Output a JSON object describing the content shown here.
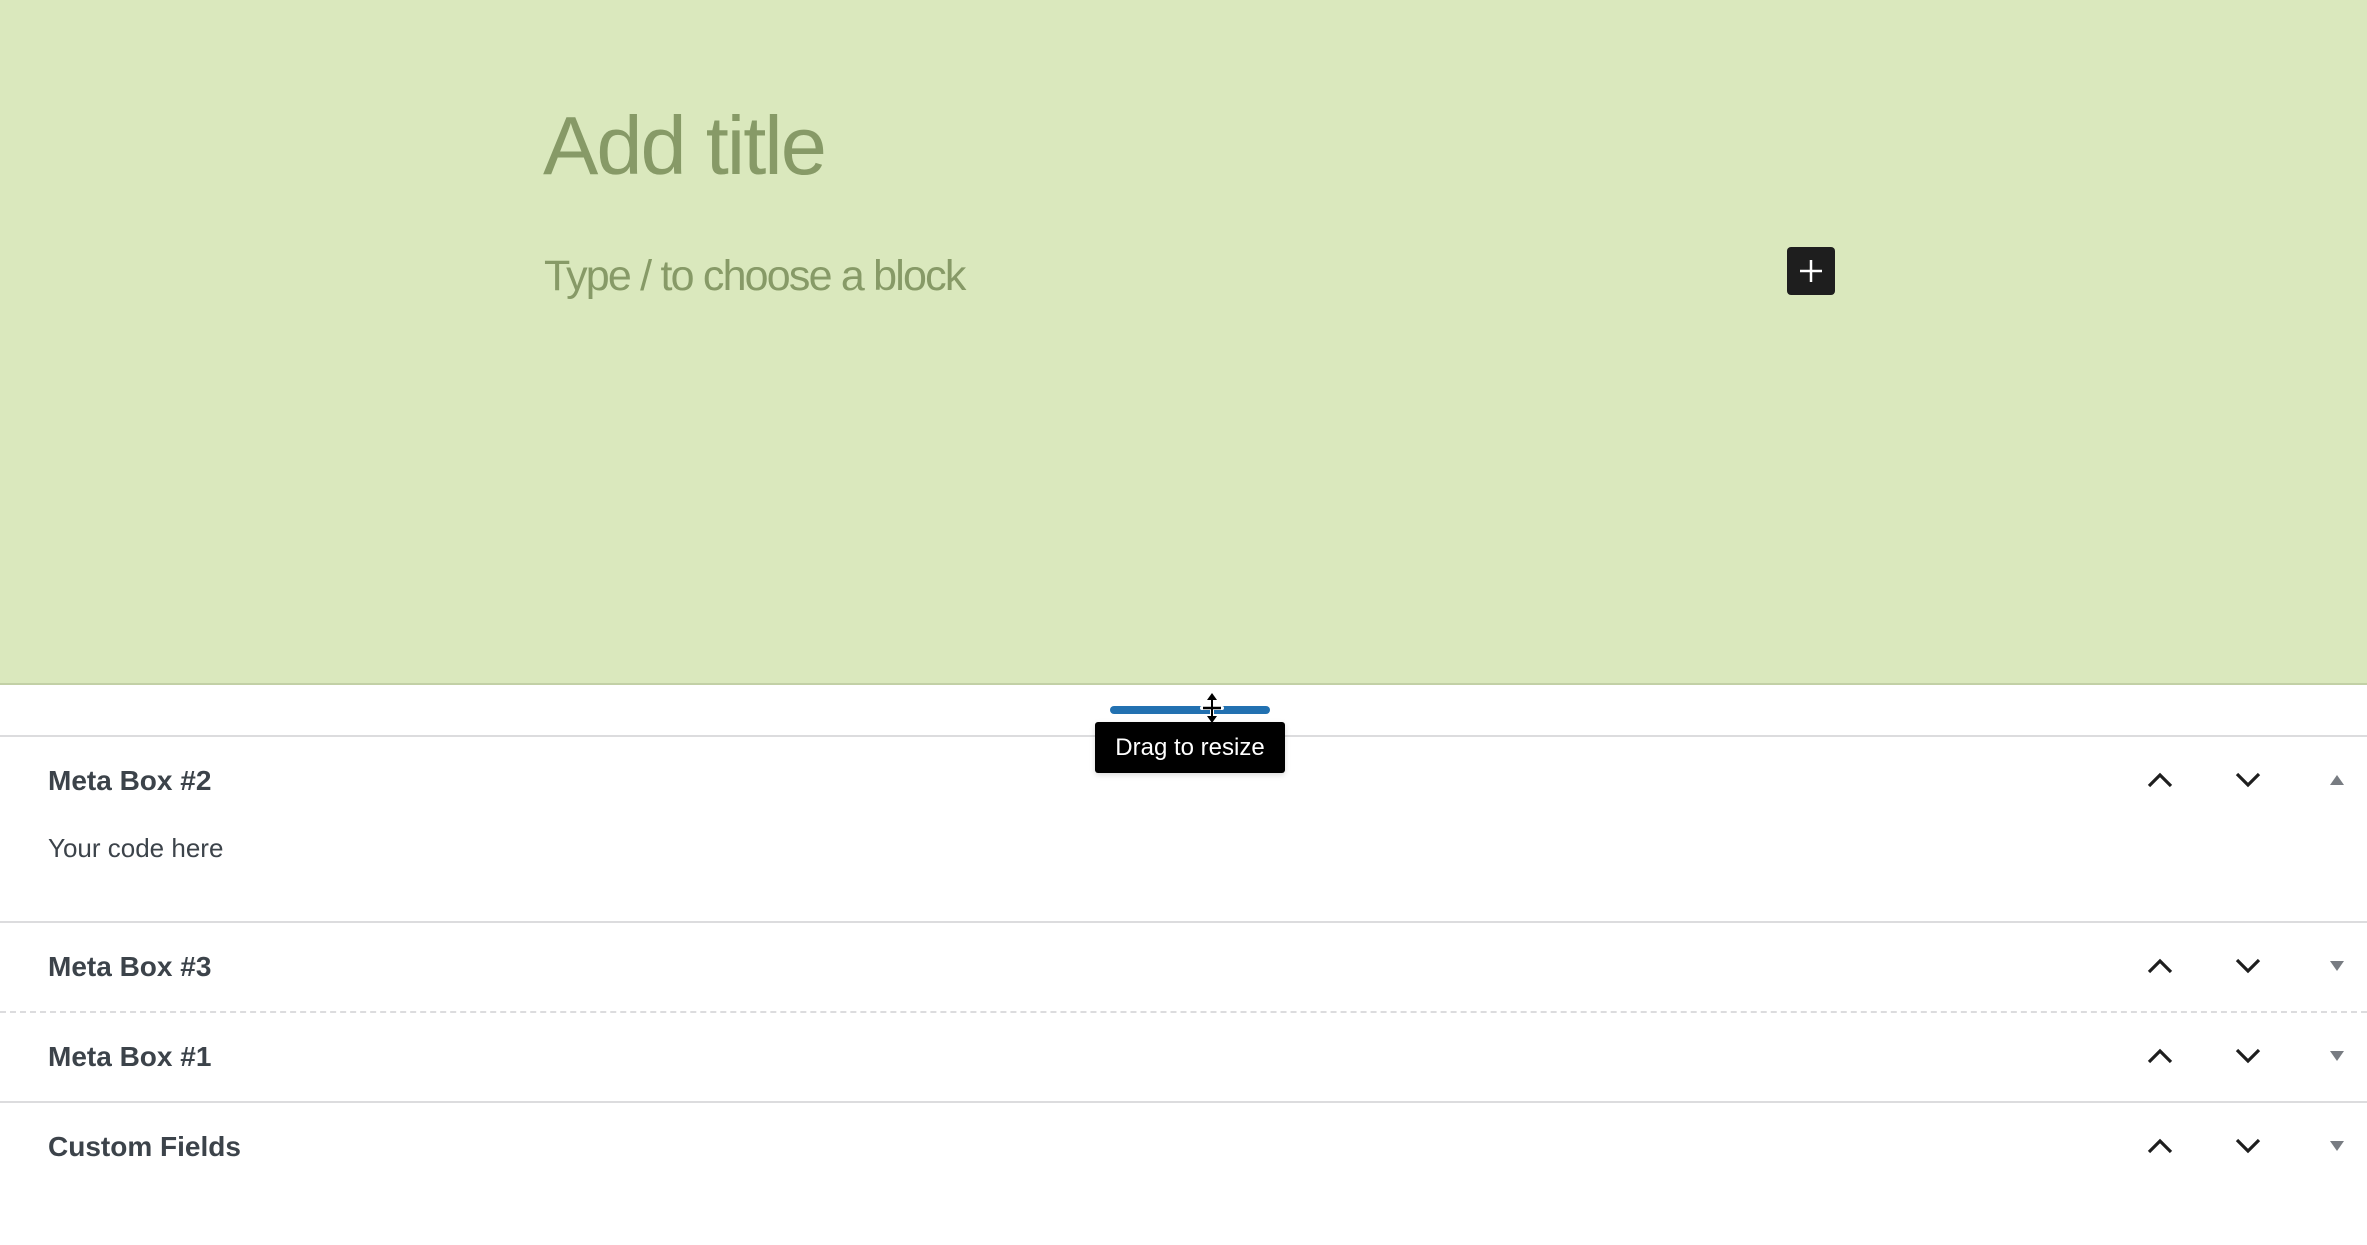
{
  "editor": {
    "background_color": "#dae8bd",
    "title_placeholder": "Add title",
    "block_placeholder": "Type / to choose a block",
    "inserter_icon": "plus-icon"
  },
  "resize": {
    "handle_color": "#2271b1",
    "tooltip": "Drag to resize",
    "cursor_icon": "resize-vertical-cursor-icon"
  },
  "metaboxes": [
    {
      "title": "Meta Box #2",
      "expanded": true,
      "content": "Your code here",
      "toggle_icon": "triangle-up-icon"
    },
    {
      "title": "Meta Box #3",
      "expanded": false,
      "toggle_icon": "triangle-down-icon"
    },
    {
      "title": "Meta Box #1",
      "expanded": false,
      "toggle_icon": "triangle-down-icon"
    },
    {
      "title": "Custom Fields",
      "expanded": false,
      "toggle_icon": "triangle-down-icon"
    }
  ],
  "controls": {
    "move_up_icon": "chevron-up-icon",
    "move_down_icon": "chevron-down-icon"
  }
}
